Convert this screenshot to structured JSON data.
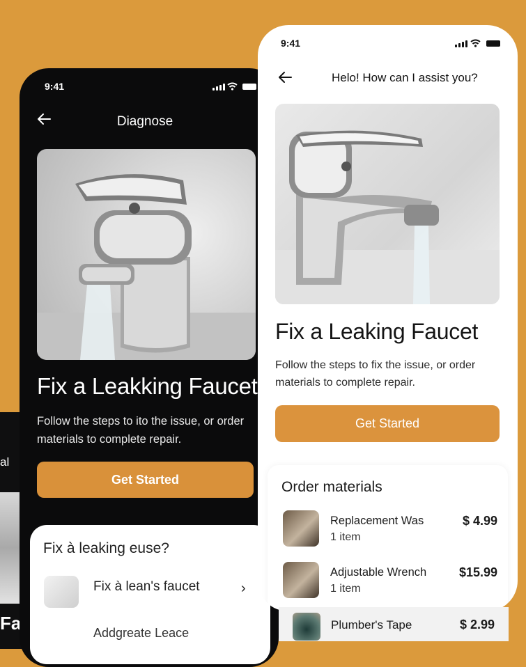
{
  "colors": {
    "background": "#DB9A3C",
    "accent": "#D9913A",
    "dark": "#0B0B0C"
  },
  "left_phone": {
    "partial_label": "al",
    "partial_title": "Faue"
  },
  "dark_phone": {
    "time": "9:41",
    "title": "Diagnose",
    "heading": "Fix a Leakking Faucet",
    "subtitle": "Follow the steps to ito the issue, or order materials to complete repair.",
    "cta": "Get Started",
    "icons": [
      "back-arrow-icon",
      "signal-icon",
      "wifi-icon",
      "battery-icon"
    ]
  },
  "popup": {
    "question": "Fix à leaking euse?",
    "item": "Fix à lean's faucet",
    "next_item": "Addgreate Leace"
  },
  "white_phone": {
    "time": "9:41",
    "title": "Helo! How can I assist you?",
    "heading": "Fix a Leaking Faucet",
    "subtitle": "Follow the steps to fix the issue, or order materials to complete repair.",
    "cta": "Get Started",
    "orders": {
      "title": "Order materials",
      "items": [
        {
          "name": "Replacement Was",
          "qty": "1 item",
          "price": "$ 4.99"
        },
        {
          "name": "Adjustable Wrench",
          "qty": "1 item",
          "price": "$15.99"
        },
        {
          "name": "Plumber's Tape",
          "price": "$ 2.99"
        }
      ]
    }
  }
}
